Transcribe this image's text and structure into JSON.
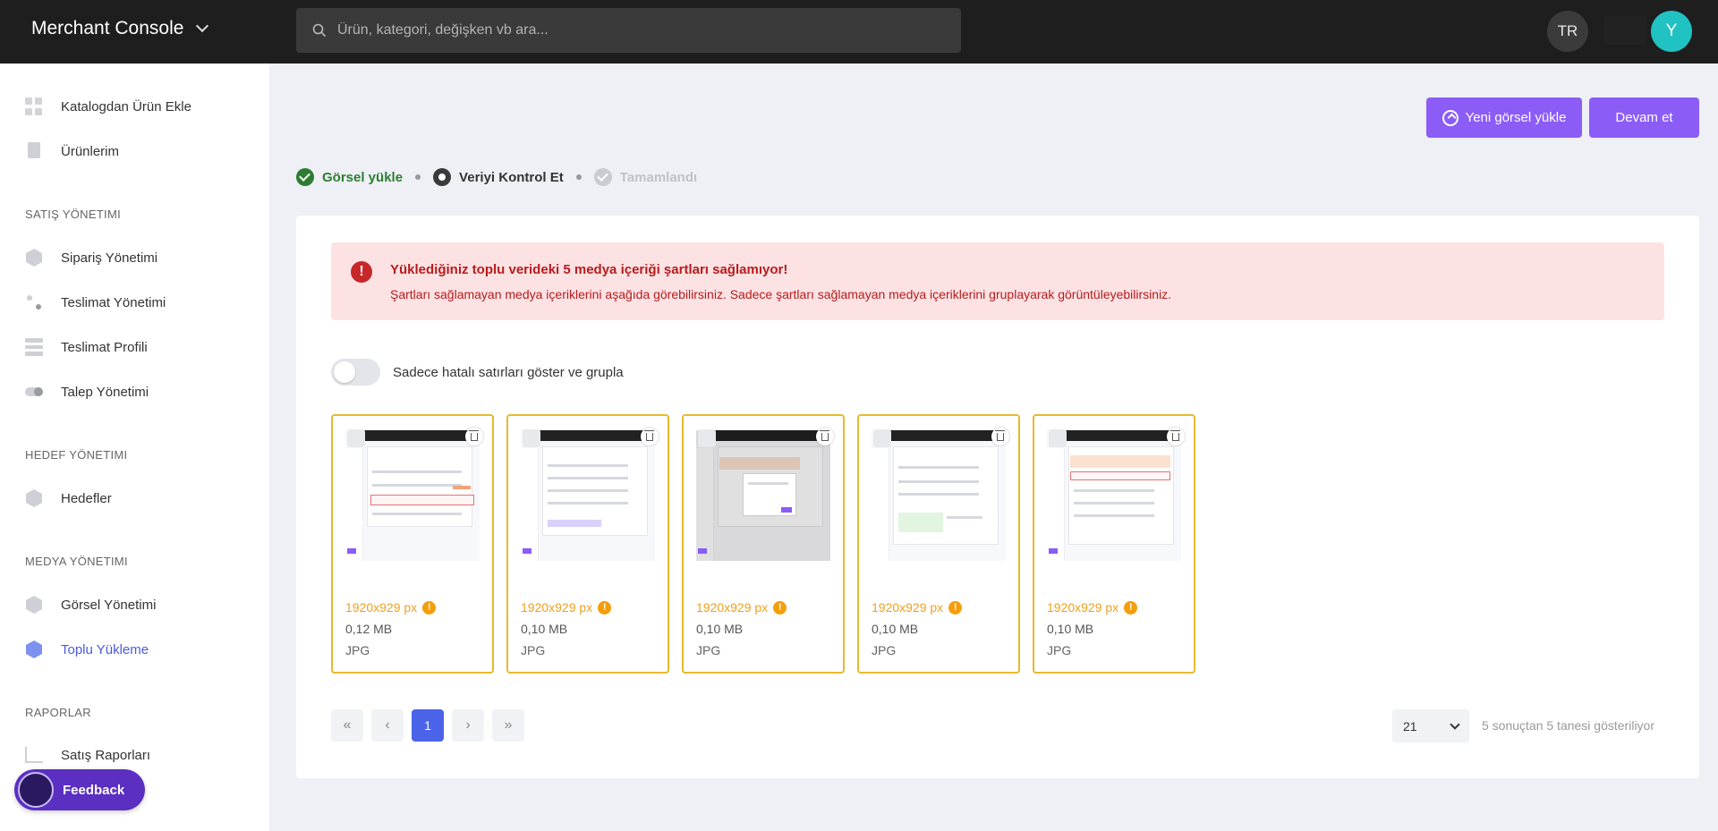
{
  "header": {
    "app_title": "Merchant Console",
    "search_placeholder": "Ürün, kategori, değişken vb ara...",
    "language": "TR",
    "avatar_initial": "Y"
  },
  "sidebar": {
    "items": [
      {
        "label": "Katalogdan Ürün Ekle",
        "icon": "grid-icon"
      },
      {
        "label": "Ürünlerim",
        "icon": "bag-icon"
      }
    ],
    "sections": [
      {
        "title": "SATIŞ YÖNETIMI",
        "items": [
          "Sipariş Yönetimi",
          "Teslimat Yönetimi",
          "Teslimat Profili",
          "Talep Yönetimi"
        ]
      },
      {
        "title": "HEDEF YÖNETIMI",
        "items": [
          "Hedefler"
        ]
      },
      {
        "title": "MEDYA YÖNETIMI",
        "items": [
          "Görsel Yönetimi",
          "Toplu Yükleme"
        ]
      },
      {
        "title": "RAPORLAR",
        "items": [
          "Satış Raporları"
        ]
      }
    ],
    "active_item": "Toplu Yükleme",
    "feedback_label": "Feedback"
  },
  "toolbar": {
    "upload_label": "Yeni görsel yükle",
    "continue_label": "Devam et"
  },
  "steps": [
    {
      "label": "Görsel yükle",
      "state": "done",
      "color": "#2e7d32"
    },
    {
      "label": "Veriyi Kontrol Et",
      "state": "current",
      "color": "#333333"
    },
    {
      "label": "Tamamlandı",
      "state": "pending",
      "color": "#c0c2c8"
    }
  ],
  "alert": {
    "title": "Yüklediğiniz toplu verideki 5 medya içeriği şartları sağlamıyor!",
    "description": "Şartları sağlamayan medya içeriklerini aşağıda görebilirsiniz. Sadece şartları sağlamayan medya içeriklerini gruplayarak görüntüleyebilirsiniz."
  },
  "filter": {
    "toggle_label": "Sadece hatalı satırları göster ve grupla",
    "toggle_on": false
  },
  "media": [
    {
      "resolution": "1920x929 px",
      "size": "0,12 MB",
      "type": "JPG"
    },
    {
      "resolution": "1920x929 px",
      "size": "0,10 MB",
      "type": "JPG"
    },
    {
      "resolution": "1920x929 px",
      "size": "0,10 MB",
      "type": "JPG"
    },
    {
      "resolution": "1920x929 px",
      "size": "0,10 MB",
      "type": "JPG"
    },
    {
      "resolution": "1920x929 px",
      "size": "0,10 MB",
      "type": "JPG"
    }
  ],
  "pagination": {
    "first": "«",
    "prev": "‹",
    "current_page": "1",
    "next": "›",
    "last": "»",
    "per_page": "21",
    "results_text": "5 sonuçtan 5 tanesi gösteriliyor"
  },
  "colors": {
    "accent": "#8b5cf6",
    "warning_border": "#e8b92e",
    "warning_text": "#f0a020",
    "error": "#b71c1c",
    "active_page": "#4a63e8"
  }
}
